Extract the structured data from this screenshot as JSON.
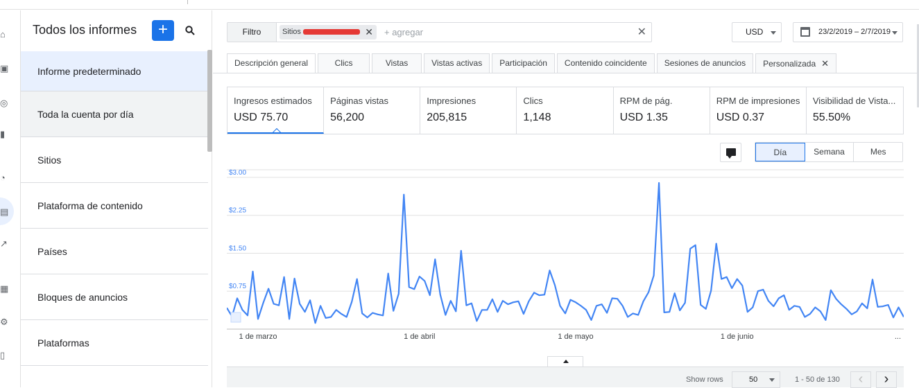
{
  "sidebar": {
    "title": "Todos los informes",
    "add_label": "+",
    "items": [
      {
        "label": "Informe predeterminado"
      },
      {
        "label": "Toda la cuenta por día"
      },
      {
        "label": "Sitios"
      },
      {
        "label": "Plataforma de contenido"
      },
      {
        "label": "Países"
      },
      {
        "label": "Bloques de anuncios"
      },
      {
        "label": "Plataformas"
      }
    ]
  },
  "filter": {
    "button_label": "Filtro",
    "chip_label": "Sitios",
    "chip_close": "✕",
    "add_placeholder": "+ agregar",
    "clear": "✕"
  },
  "currency": {
    "value": "USD"
  },
  "date_range": {
    "value": "23/2/2019 – 2/7/2019"
  },
  "tabs": [
    {
      "label": "Descripción general",
      "active": true
    },
    {
      "label": "Clics"
    },
    {
      "label": "Vistas"
    },
    {
      "label": "Vistas activas"
    },
    {
      "label": "Participación"
    },
    {
      "label": "Contenido coincidente"
    },
    {
      "label": "Sesiones de anuncios"
    },
    {
      "label": "Personalizada",
      "close": "✕"
    }
  ],
  "metrics": [
    {
      "label": "Ingresos estimados",
      "value": "USD 75.70",
      "selected": true
    },
    {
      "label": "Páginas vistas",
      "value": "56,200"
    },
    {
      "label": "Impresiones",
      "value": "205,815"
    },
    {
      "label": "Clics",
      "value": "1,148"
    },
    {
      "label": "RPM de pág.",
      "value": "USD 1.35"
    },
    {
      "label": "RPM de impresiones",
      "value": "USD 0.37"
    },
    {
      "label": "Visibilidad de Vista...",
      "value": "55.50%"
    }
  ],
  "granularity": {
    "options": [
      "Día",
      "Semana",
      "Mes"
    ],
    "selected": "Día"
  },
  "chart_data": {
    "type": "line",
    "series": [
      {
        "color": "#4285f4",
        "values": [
          0.42,
          0.25,
          0.61,
          0.38,
          0.27,
          1.14,
          0.2,
          0.52,
          0.8,
          0.5,
          0.47,
          1.03,
          0.2,
          1.0,
          0.5,
          0.34,
          0.57,
          0.12,
          0.46,
          0.22,
          0.24,
          0.38,
          0.3,
          0.24,
          0.54,
          0.99,
          0.31,
          0.23,
          0.32,
          0.29,
          0.27,
          1.1,
          0.36,
          0.7,
          2.66,
          0.83,
          0.79,
          1.04,
          0.95,
          0.67,
          1.38,
          0.68,
          0.28,
          0.56,
          0.35,
          1.55,
          0.47,
          0.51,
          0.16,
          0.38,
          0.38,
          0.59,
          0.34,
          0.56,
          0.49,
          0.53,
          0.55,
          0.3,
          0.55,
          0.72,
          0.67,
          0.68,
          1.16,
          0.87,
          0.46,
          0.31,
          0.58,
          0.53,
          0.46,
          0.38,
          0.18,
          0.46,
          0.49,
          0.32,
          0.61,
          0.6,
          0.46,
          0.24,
          0.31,
          0.28,
          0.55,
          0.73,
          1.06,
          2.89,
          0.33,
          0.34,
          0.71,
          0.37,
          0.52,
          1.59,
          1.66,
          0.48,
          0.4,
          0.76,
          1.69,
          0.99,
          1.03,
          0.81,
          0.99,
          0.86,
          0.34,
          0.43,
          0.75,
          0.78,
          0.56,
          0.45,
          0.61,
          0.67,
          0.38,
          0.46,
          0.44,
          0.24,
          0.3,
          0.43,
          0.35,
          0.18,
          0.77,
          0.6,
          0.49,
          0.4,
          0.29,
          0.35,
          0.51,
          0.41,
          0.98,
          0.44,
          0.45,
          0.48,
          0.23,
          0.43,
          0.24
        ]
      }
    ],
    "x_tick_labels": [
      "1 de marzo",
      "1 de abril",
      "1 de mayo",
      "1 de junio"
    ],
    "x_more": "...",
    "y_tick_labels": [
      "$3.00",
      "$2.25",
      "$1.50",
      "$0.75"
    ],
    "y_ticks": [
      3.0,
      2.25,
      1.5,
      0.75
    ],
    "ylim": [
      0,
      3.15
    ],
    "grid": true
  },
  "table_footer": {
    "show_rows_label": "Show rows",
    "rows_value": "50",
    "page_info": "1 - 50 de 130",
    "prev": "‹",
    "next": "›"
  }
}
